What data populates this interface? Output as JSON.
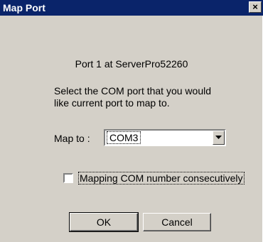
{
  "window": {
    "title": "Map Port",
    "close_label": "×"
  },
  "content": {
    "port_heading": "Port 1 at ServerPro52260",
    "instruction_line1": "Select the COM port that you would",
    "instruction_line2": "like current port to map to.",
    "map_to_label": "Map to :",
    "map_to_value": "COM3",
    "checkbox_label": "Mapping COM number consecutively",
    "checkbox_checked": false
  },
  "buttons": {
    "ok": "OK",
    "cancel": "Cancel"
  },
  "colors": {
    "titlebar": "#0a246a",
    "face": "#d4d0c8"
  }
}
